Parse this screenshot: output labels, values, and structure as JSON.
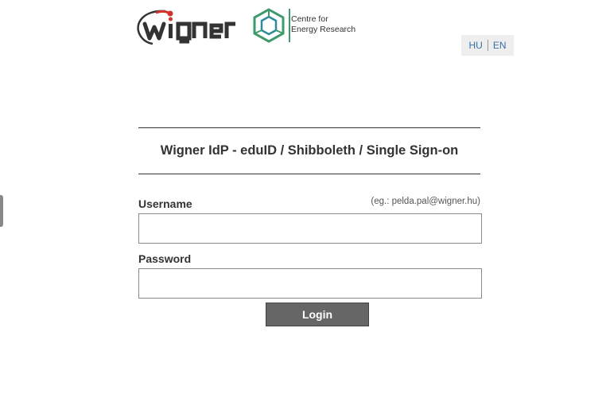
{
  "header": {
    "wigner_logo_text": "wigner",
    "cer_logo_line1": "Centre for",
    "cer_logo_line2": "Energy Research"
  },
  "language": {
    "hu": "HU",
    "en": "EN"
  },
  "title": "Wigner IdP - eduID / Shibboleth / Single Sign-on",
  "form": {
    "username_label": "Username",
    "username_hint": "(eg.: pelda.pal@wigner.hu)",
    "username_value": "",
    "password_label": "Password",
    "password_value": "",
    "login_label": "Login"
  },
  "colors": {
    "wigner_red": "#d0342c",
    "cer_green": "#3d9a6a",
    "cer_teal": "#2c8c9a",
    "button_bg": "#666666",
    "link": "#3a6ea8"
  }
}
